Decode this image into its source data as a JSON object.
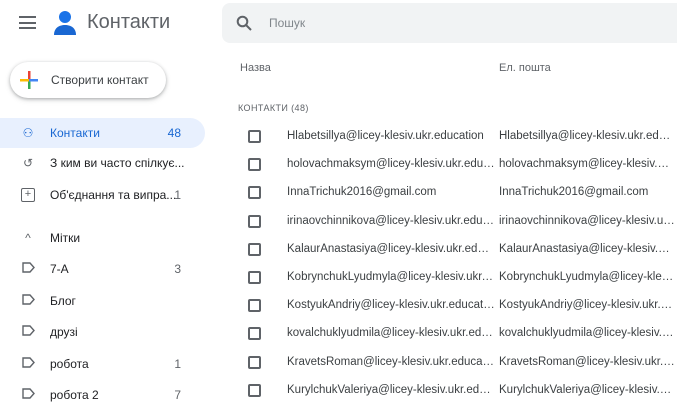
{
  "app": {
    "title": "Контакти"
  },
  "create_button": {
    "label": "Створити контакт"
  },
  "nav": [
    {
      "label": "Контакти",
      "count": "48",
      "icon": "person-icon",
      "active": true
    },
    {
      "label": "З ким ви часто спілкує...",
      "count": "",
      "icon": "history-icon"
    },
    {
      "label": "Об'єднання та випра...",
      "count": "1",
      "icon": "merge-icon"
    }
  ],
  "labels_header": {
    "label": "Мітки"
  },
  "labels": [
    {
      "label": "7-А",
      "count": "3"
    },
    {
      "label": "Блог",
      "count": ""
    },
    {
      "label": "друзі",
      "count": ""
    },
    {
      "label": "робота",
      "count": "1"
    },
    {
      "label": "робота 2",
      "count": "7"
    }
  ],
  "search": {
    "placeholder": "Пошук"
  },
  "table": {
    "columns": [
      "Назва",
      "Ел. пошта"
    ],
    "section_label": "КОНТАКТИ (48)",
    "rows": [
      {
        "name": "Hlabetsillya@licey-klesiv.ukr.education",
        "email": "Hlabetsillya@licey-klesiv.ukr.education"
      },
      {
        "name": "holovachmaksym@licey-klesiv.ukr.education",
        "email": "holovachmaksym@licey-klesiv.ukr.education"
      },
      {
        "name": "InnaTrichuk2016@gmail.com",
        "email": "InnaTrichuk2016@gmail.com"
      },
      {
        "name": "irinaovchinnikova@licey-klesiv.ukr.education",
        "email": "irinaovchinnikova@licey-klesiv.ukr.education"
      },
      {
        "name": "KalaurAnastasiya@licey-klesiv.ukr.education",
        "email": "KalaurAnastasiya@licey-klesiv.ukr.education"
      },
      {
        "name": "KobrynchukLyudmyla@licey-klesiv.ukr.education",
        "email": "KobrynchukLyudmyla@licey-klesiv.ukr.education"
      },
      {
        "name": "KostyukAndriy@licey-klesiv.ukr.education",
        "email": "KostyukAndriy@licey-klesiv.ukr.education"
      },
      {
        "name": "kovalchuklyudmila@licey-klesiv.ukr.education",
        "email": "kovalchuklyudmila@licey-klesiv.ukr.education"
      },
      {
        "name": "KravetsRoman@licey-klesiv.ukr.education",
        "email": "KravetsRoman@licey-klesiv.ukr.education"
      },
      {
        "name": "KurylchukValeriya@licey-klesiv.ukr.education",
        "email": "KurylchukValeriya@licey-klesiv.ukr.education"
      }
    ]
  },
  "colors": {
    "accent": "#1967d2",
    "active_bg": "#e8f0fe",
    "search_bg": "#f1f3f4"
  }
}
